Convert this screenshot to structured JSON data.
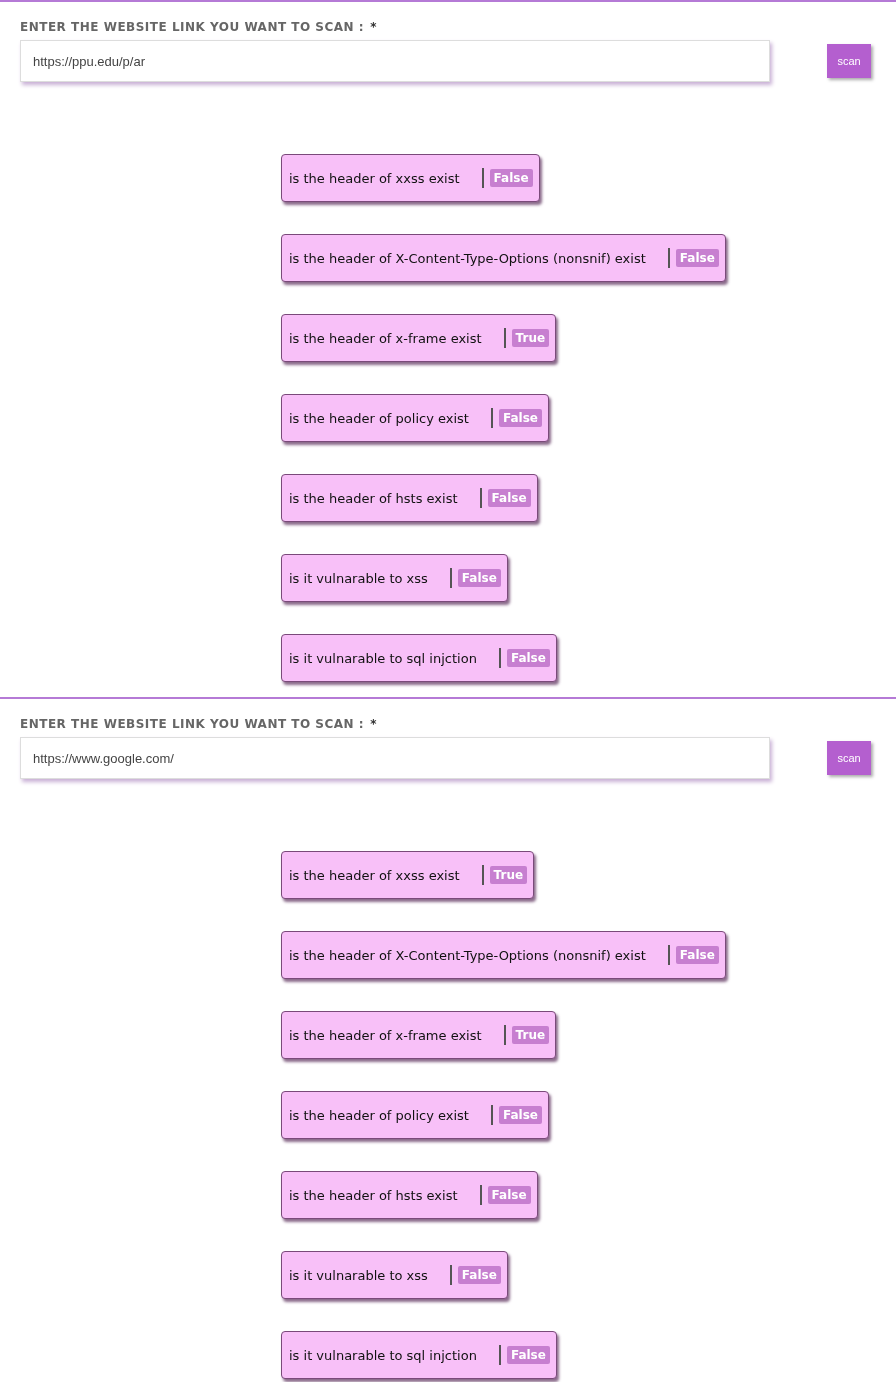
{
  "scans": [
    {
      "label": "ENTER THE WEBSITE LINK YOU WANT TO SCAN :",
      "required_mark": "*",
      "url": "https://ppu.edu/p/ar",
      "button": "scan",
      "results": [
        {
          "question": "is the header of xxss exist",
          "answer": "False"
        },
        {
          "question": "is the header of X-Content-Type-Options (nonsnif) exist",
          "answer": "False"
        },
        {
          "question": "is the header of x-frame exist",
          "answer": "True"
        },
        {
          "question": "is the header of policy exist",
          "answer": "False"
        },
        {
          "question": "is the header of hsts exist",
          "answer": "False"
        },
        {
          "question": "is it vulnarable to xss",
          "answer": "False"
        },
        {
          "question": "is it vulnarable to sql injction",
          "answer": "False"
        }
      ]
    },
    {
      "label": "ENTER THE WEBSITE LINK YOU WANT TO SCAN :",
      "required_mark": "*",
      "url": "https://www.google.com/",
      "button": "scan",
      "results": [
        {
          "question": "is the header of xxss exist",
          "answer": "True"
        },
        {
          "question": "is the header of X-Content-Type-Options (nonsnif) exist",
          "answer": "False"
        },
        {
          "question": "is the header of x-frame exist",
          "answer": "True"
        },
        {
          "question": "is the header of policy exist",
          "answer": "False"
        },
        {
          "question": "is the header of hsts exist",
          "answer": "False"
        },
        {
          "question": "is it vulnarable to xss",
          "answer": "False"
        },
        {
          "question": "is it vulnarable to sql injction",
          "answer": "False"
        }
      ]
    }
  ]
}
